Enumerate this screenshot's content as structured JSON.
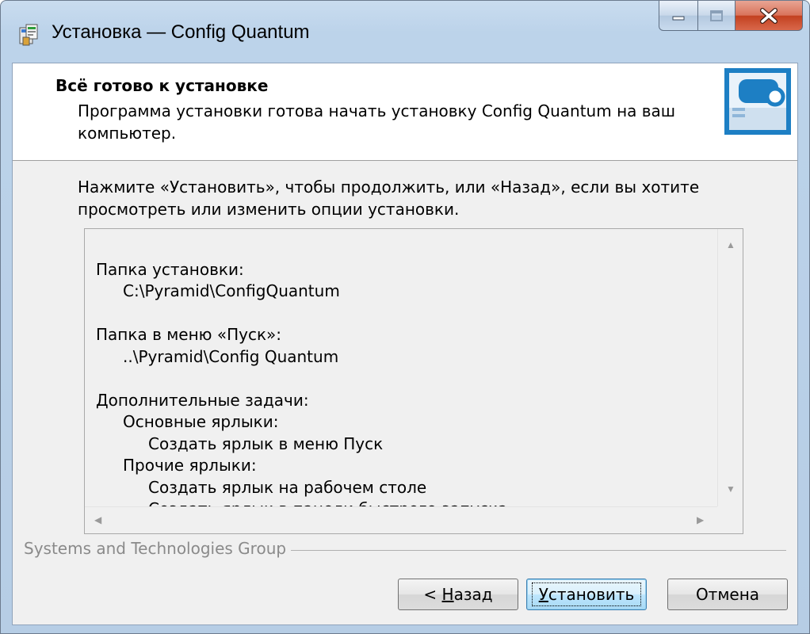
{
  "window": {
    "title": "Установка — Config Quantum",
    "controls": {
      "minimize": "minimize",
      "maximize": "maximize",
      "close": "close"
    }
  },
  "header": {
    "title": "Всё готово к установке",
    "subtitle": "Программа установки готова начать установку Config Quantum на ваш компьютер."
  },
  "intro": "Нажмите «Установить», чтобы продолжить, или «Назад», если вы хотите просмотреть или изменить опции установки.",
  "summary": {
    "install_folder_label": "Папка установки:",
    "install_folder_value": "C:\\Pyramid\\ConfigQuantum",
    "start_menu_label": "Папка в меню «Пуск»:",
    "start_menu_value": "..\\Pyramid\\Config Quantum",
    "tasks_label": "Дополнительные задачи:",
    "tasks_group1": "Основные ярлыки:",
    "tasks_group1_item1": "Создать ярлык в меню Пуск",
    "tasks_group2": "Прочие ярлыки:",
    "tasks_group2_item1": "Создать ярлык на рабочем столе",
    "tasks_group2_item2": "Создать ярлык в панели быстрого запуска"
  },
  "footer": {
    "group_label": "Systems and Technologies Group"
  },
  "buttons": {
    "back_prefix": "< ",
    "back_mnemonic": "Н",
    "back_rest": "азад",
    "install_mnemonic": "У",
    "install_rest": "становить",
    "cancel": "Отмена"
  },
  "colors": {
    "titlebar": "#bcd3ea",
    "close_button": "#c2401f",
    "panel_bg": "#f0f0f0",
    "default_button_border": "#3c7fb1"
  }
}
